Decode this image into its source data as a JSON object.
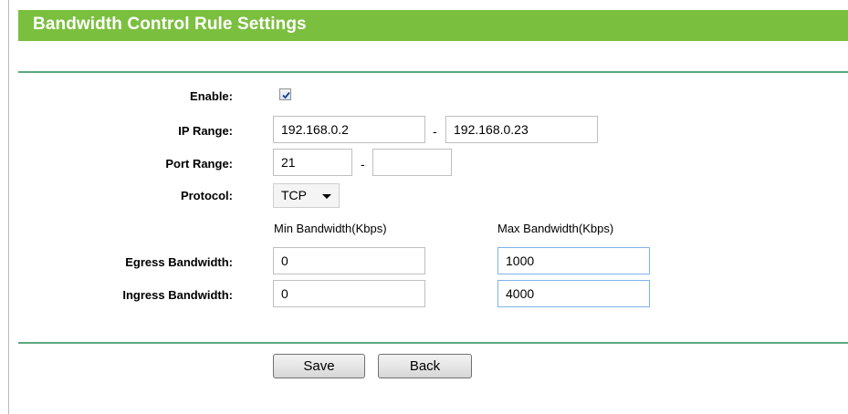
{
  "header": {
    "title": "Bandwidth Control Rule Settings"
  },
  "form": {
    "enable": {
      "label": "Enable:",
      "checked": true
    },
    "ip_range": {
      "label": "IP Range:",
      "start": "192.168.0.2",
      "separator": "-",
      "end": "192.168.0.23"
    },
    "port_range": {
      "label": "Port Range:",
      "start": "21",
      "separator": "-",
      "end": ""
    },
    "protocol": {
      "label": "Protocol:",
      "selected": "TCP"
    },
    "bandwidth_headers": {
      "min": "Min Bandwidth(Kbps)",
      "max": "Max Bandwidth(Kbps)"
    },
    "egress": {
      "label": "Egress Bandwidth:",
      "min": "0",
      "max": "1000"
    },
    "ingress": {
      "label": "Ingress Bandwidth:",
      "min": "0",
      "max": "4000"
    }
  },
  "buttons": {
    "save": "Save",
    "back": "Back"
  },
  "colors": {
    "header_bg": "#7bbf3f",
    "divider": "#5aa87c",
    "focus_border": "#7eb4ea"
  }
}
